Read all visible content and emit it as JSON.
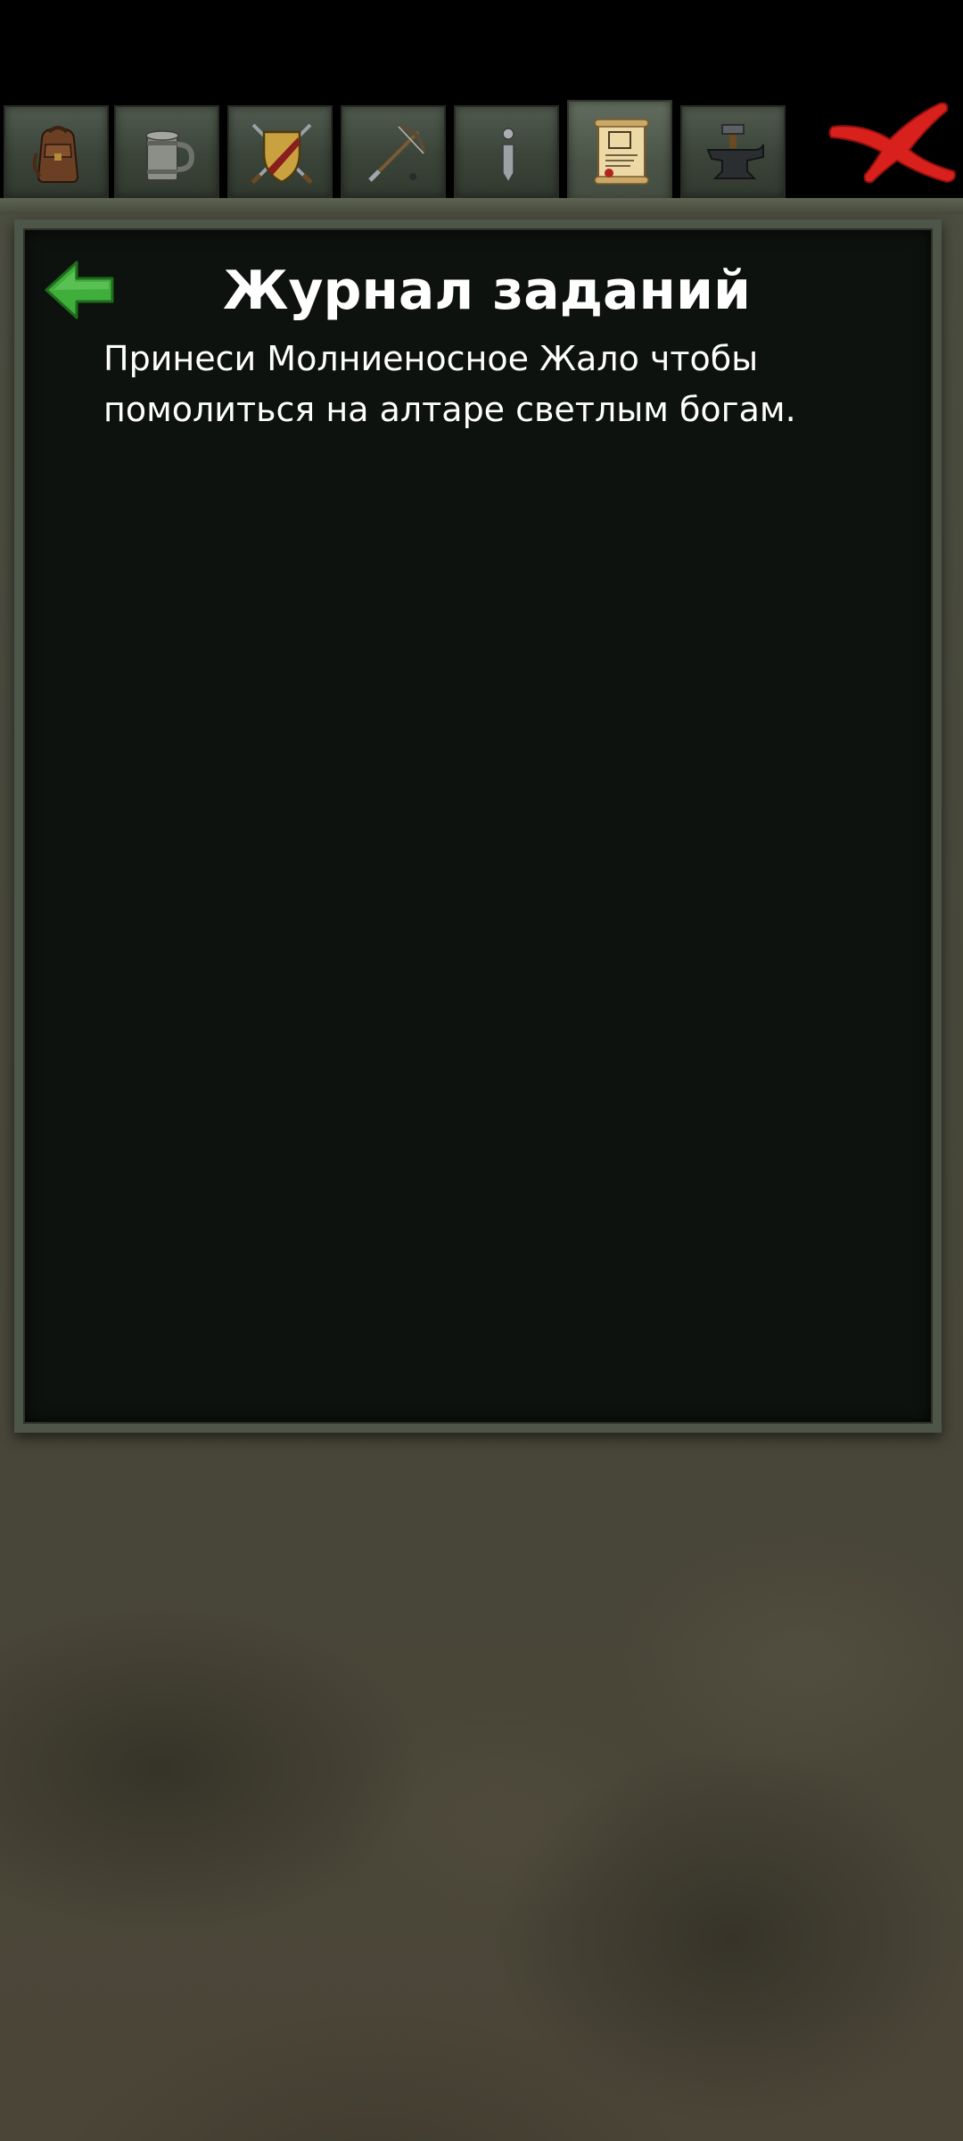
{
  "tabs": [
    {
      "name": "backpack",
      "icon": "backpack-icon",
      "active": false
    },
    {
      "name": "tavern",
      "icon": "tankard-icon",
      "active": false
    },
    {
      "name": "equipment",
      "icon": "shield-swords-icon",
      "active": false
    },
    {
      "name": "skills",
      "icon": "crossbow-icon",
      "active": false
    },
    {
      "name": "info",
      "icon": "info-icon",
      "active": false
    },
    {
      "name": "quests",
      "icon": "scroll-icon",
      "active": true
    },
    {
      "name": "crafting",
      "icon": "anvil-icon",
      "active": false
    }
  ],
  "close": {
    "icon": "close-icon",
    "color": "#d8201c"
  },
  "journal": {
    "title": "Журнал заданий",
    "quest_text": "Принеси Молниеносное Жало чтобы помолиться на алтаре светлым богам.",
    "back_icon": "back-arrow-icon",
    "back_color": "#3fae3a"
  }
}
